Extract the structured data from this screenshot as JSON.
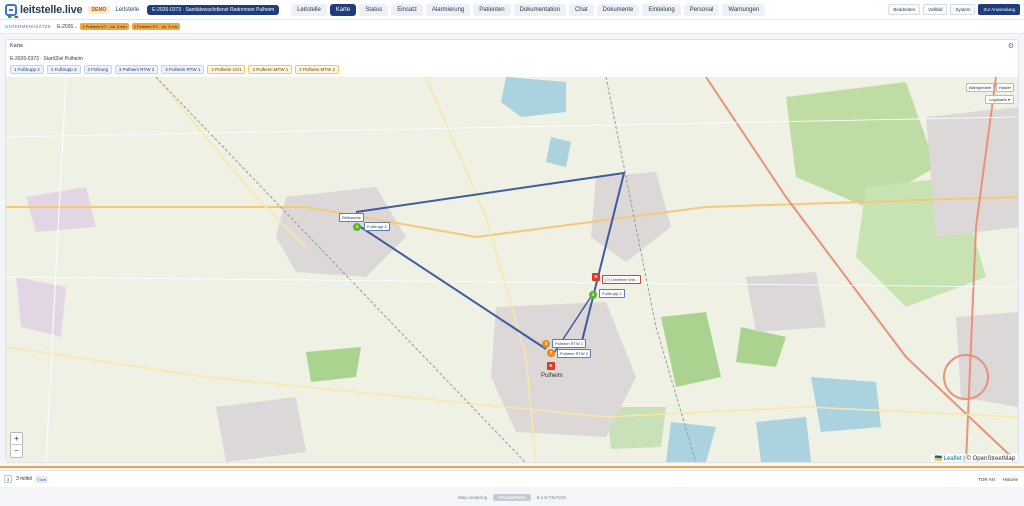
{
  "app": {
    "brand": "leitstelle.live",
    "demo": "DEMO",
    "top_link": "Leitstelle",
    "incident": "E-2026-0373 · Sanitätswachdienst Radrennen Pulheim"
  },
  "nav": [
    "Leitstelle",
    "Karte",
    "Status",
    "Einsatz",
    "Alarmierung",
    "Patienten",
    "Dokumentation",
    "Chat",
    "Dokumente",
    "Einteilung",
    "Personal",
    "Warnungen"
  ],
  "nav_active": "Karte",
  "right_buttons": [
    "Bearbeiten",
    "Vollbild",
    "System",
    "Zur Anwendung"
  ],
  "subbar": {
    "label": "UNTERMENÜSÄTZE",
    "id": "E-2026...",
    "chips": [
      "2 Pulheim KT... ca. 3 min",
      "3 Pulheim KT... ca. 3 min"
    ]
  },
  "card": {
    "title": "Karte",
    "subtitle": "E-2026-0373 · Start/Ziel Pulheim"
  },
  "unit_chips": [
    {
      "text": "1 Fußtrupp 2",
      "yellow": false
    },
    {
      "text": "1 Fußtrupp 3",
      "yellow": false
    },
    {
      "text": "2 Führung",
      "yellow": false
    },
    {
      "text": "3 Pulheim RTW 2",
      "yellow": false
    },
    {
      "text": "3 Pulheim RTW 1",
      "yellow": false
    },
    {
      "text": "2 Pulheim 10/1",
      "yellow": true
    },
    {
      "text": "2 Pulheim MTW 1",
      "yellow": true
    },
    {
      "text": "2 Pulheim MTW 2",
      "yellow": true
    }
  ],
  "map": {
    "controls": [
      "Warngebiete",
      "Raster"
    ],
    "layer": "Logokarte",
    "zoom_in": "+",
    "zoom_out": "−",
    "attribution_leaflet": "Leaflet",
    "attribution_osm": "© OpenStreetMap",
    "town": "Pulheim",
    "labels": {
      "rettwache": "Rettwache",
      "ft3": "Fußtrupp 3",
      "ft2": "Fußtrupp 2",
      "rtw1": "Pulheim RTW 1",
      "rtw2": "Pulheim RTW 2",
      "incident": "(?) Unwetter Wie..."
    },
    "markers": {
      "ft3": "1",
      "ft2": "1",
      "rtw1": "3",
      "rtw2": "3",
      "hq": "E"
    }
  },
  "status": {
    "icon": "3",
    "count": "3 mittel",
    "badge": "7 km",
    "right": [
      "TOR AN",
      "Historie"
    ]
  },
  "footer": {
    "left": "Map rendering",
    "button": "PAUSIEREN",
    "version": "8.1.0-73e7223"
  }
}
